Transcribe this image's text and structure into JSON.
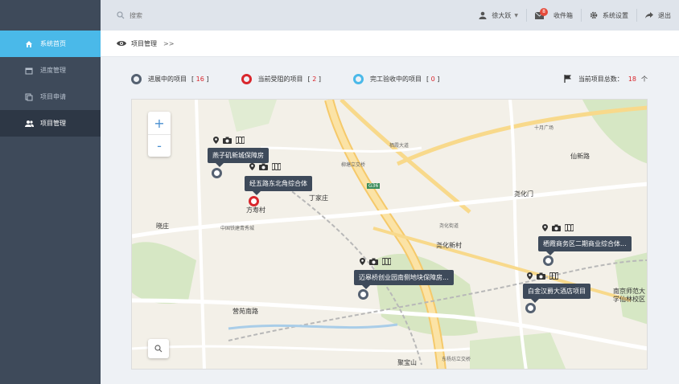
{
  "colors": {
    "sidebar_bg": "#3e4a5a",
    "active_blue": "#4ab9e9",
    "active_dark": "#2d3745",
    "status_progress": "#556171",
    "status_blocked": "#d9262c",
    "status_done": "#4ab9e9"
  },
  "sidebar": {
    "items": [
      {
        "label": "系统首页",
        "icon": "home-icon"
      },
      {
        "label": "进度管理",
        "icon": "calendar-icon"
      },
      {
        "label": "项目申请",
        "icon": "copy-icon"
      },
      {
        "label": "项目管理",
        "icon": "users-icon"
      }
    ]
  },
  "topbar": {
    "search_placeholder": "搜索",
    "user": "徐大跃",
    "inbox_label": "收件箱",
    "inbox_count": "8",
    "settings_label": "系统设置",
    "logout_label": "退出"
  },
  "breadcrumb": {
    "title": "项目管理",
    "sep": ">>"
  },
  "legend": {
    "in_progress": {
      "label": "进展中的项目",
      "count": "16"
    },
    "blocked": {
      "label": "当前受阻的项目",
      "count": "2"
    },
    "done": {
      "label": "完工验收中的项目",
      "count": "0"
    },
    "total_label": "当前项目总数：",
    "total_value": "18",
    "total_unit": "个"
  },
  "map": {
    "zoom_in": "+",
    "zoom_out": "-",
    "projects": [
      {
        "name": "燕子矶新城保障房",
        "status": "in_progress"
      },
      {
        "name": "经五路东北角综合体",
        "status": "blocked"
      },
      {
        "name": "迈皋桥创业园南侧地块保障房...",
        "status": "in_progress"
      },
      {
        "name": "栖霞商务区二期商业综合体...",
        "status": "in_progress"
      },
      {
        "name": "白金汉爵大酒店项目",
        "status": "in_progress"
      }
    ],
    "places": {
      "p1": "丁家庄",
      "p2": "方寿村",
      "p3": "晓庄",
      "p4": "尧化新村",
      "p5": "尧化门",
      "p6": "仙新路",
      "p7": "营苑南路",
      "p8": "聚宝山",
      "p9": "南京师范大学仙林校区",
      "p10": "G36",
      "p11": "栖霞大道",
      "p12": "十月广场",
      "p13": "中国铁建青秀城",
      "p14": "柳塘立交桥",
      "p15": "尧化街道",
      "p16": "东杨坊立交桥"
    }
  }
}
